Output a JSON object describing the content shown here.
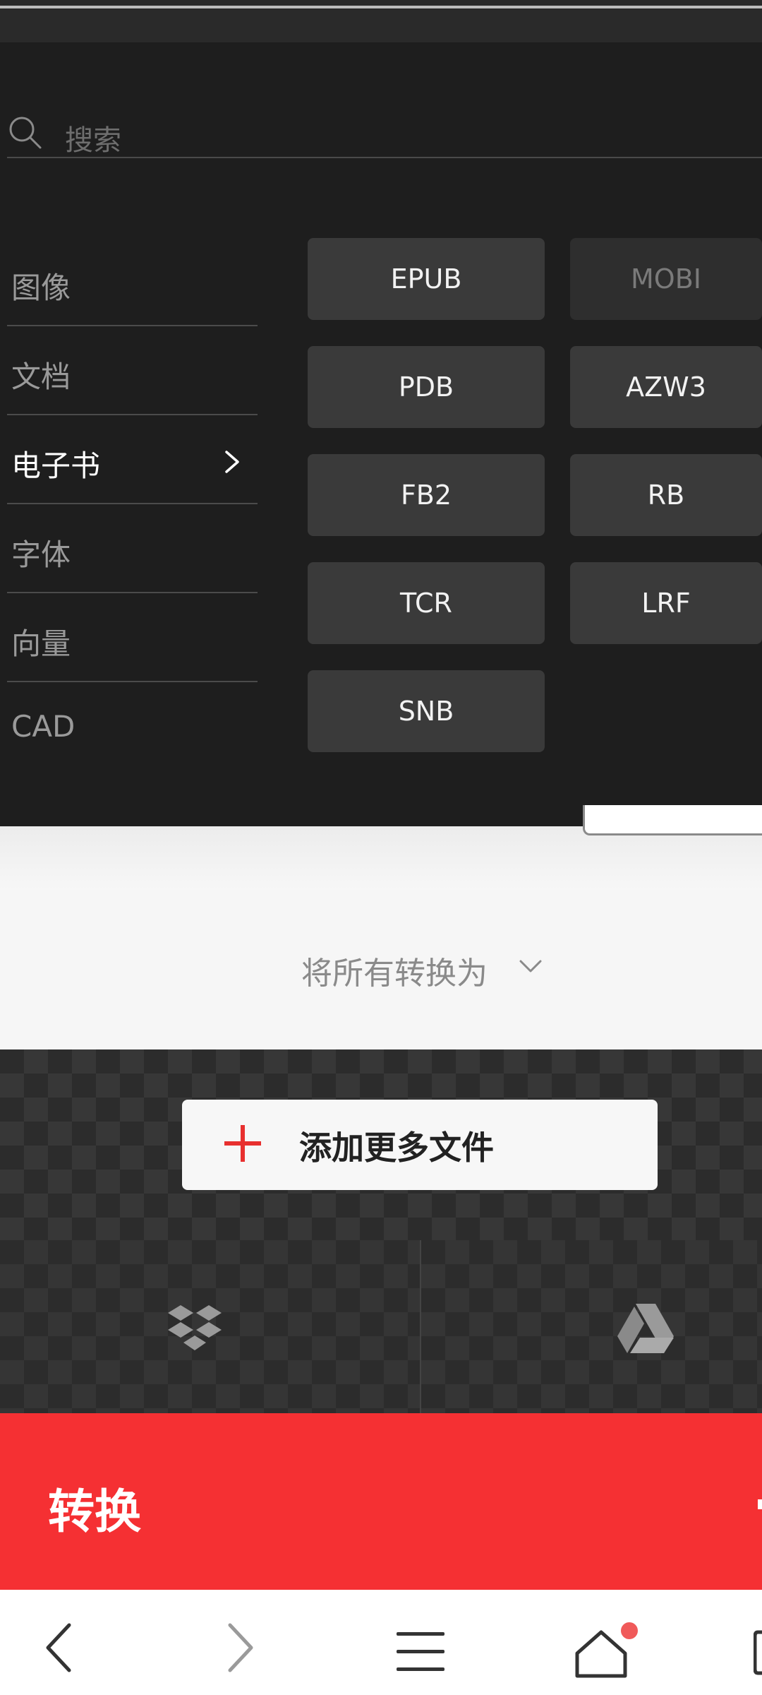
{
  "search": {
    "placeholder": "搜索"
  },
  "categories": [
    {
      "label": "图像",
      "active": false
    },
    {
      "label": "文档",
      "active": false
    },
    {
      "label": "电子书",
      "active": true
    },
    {
      "label": "字体",
      "active": false
    },
    {
      "label": "向量",
      "active": false
    },
    {
      "label": "CAD",
      "active": false
    }
  ],
  "formats": {
    "epub": "EPUB",
    "mobi": "MOBI",
    "pdb": "PDB",
    "azw3": "AZW3",
    "fb2": "FB2",
    "rb": "RB",
    "tcr": "TCR",
    "lrf": "LRF",
    "snb": "SNB"
  },
  "convert_all": {
    "label": "将所有转换为"
  },
  "add_files": {
    "label": "添加更多文件"
  },
  "cloud": {
    "left_icon": "dropbox-icon",
    "right_icon": "google-drive-icon"
  },
  "convert_button": {
    "label": "转换"
  },
  "colors": {
    "accent": "#f53033",
    "panel": "#1e1e1e",
    "tile": "#3a3a3a"
  },
  "nav": [
    "back-icon",
    "forward-icon",
    "menu-icon",
    "home-icon",
    "tabs-icon"
  ]
}
